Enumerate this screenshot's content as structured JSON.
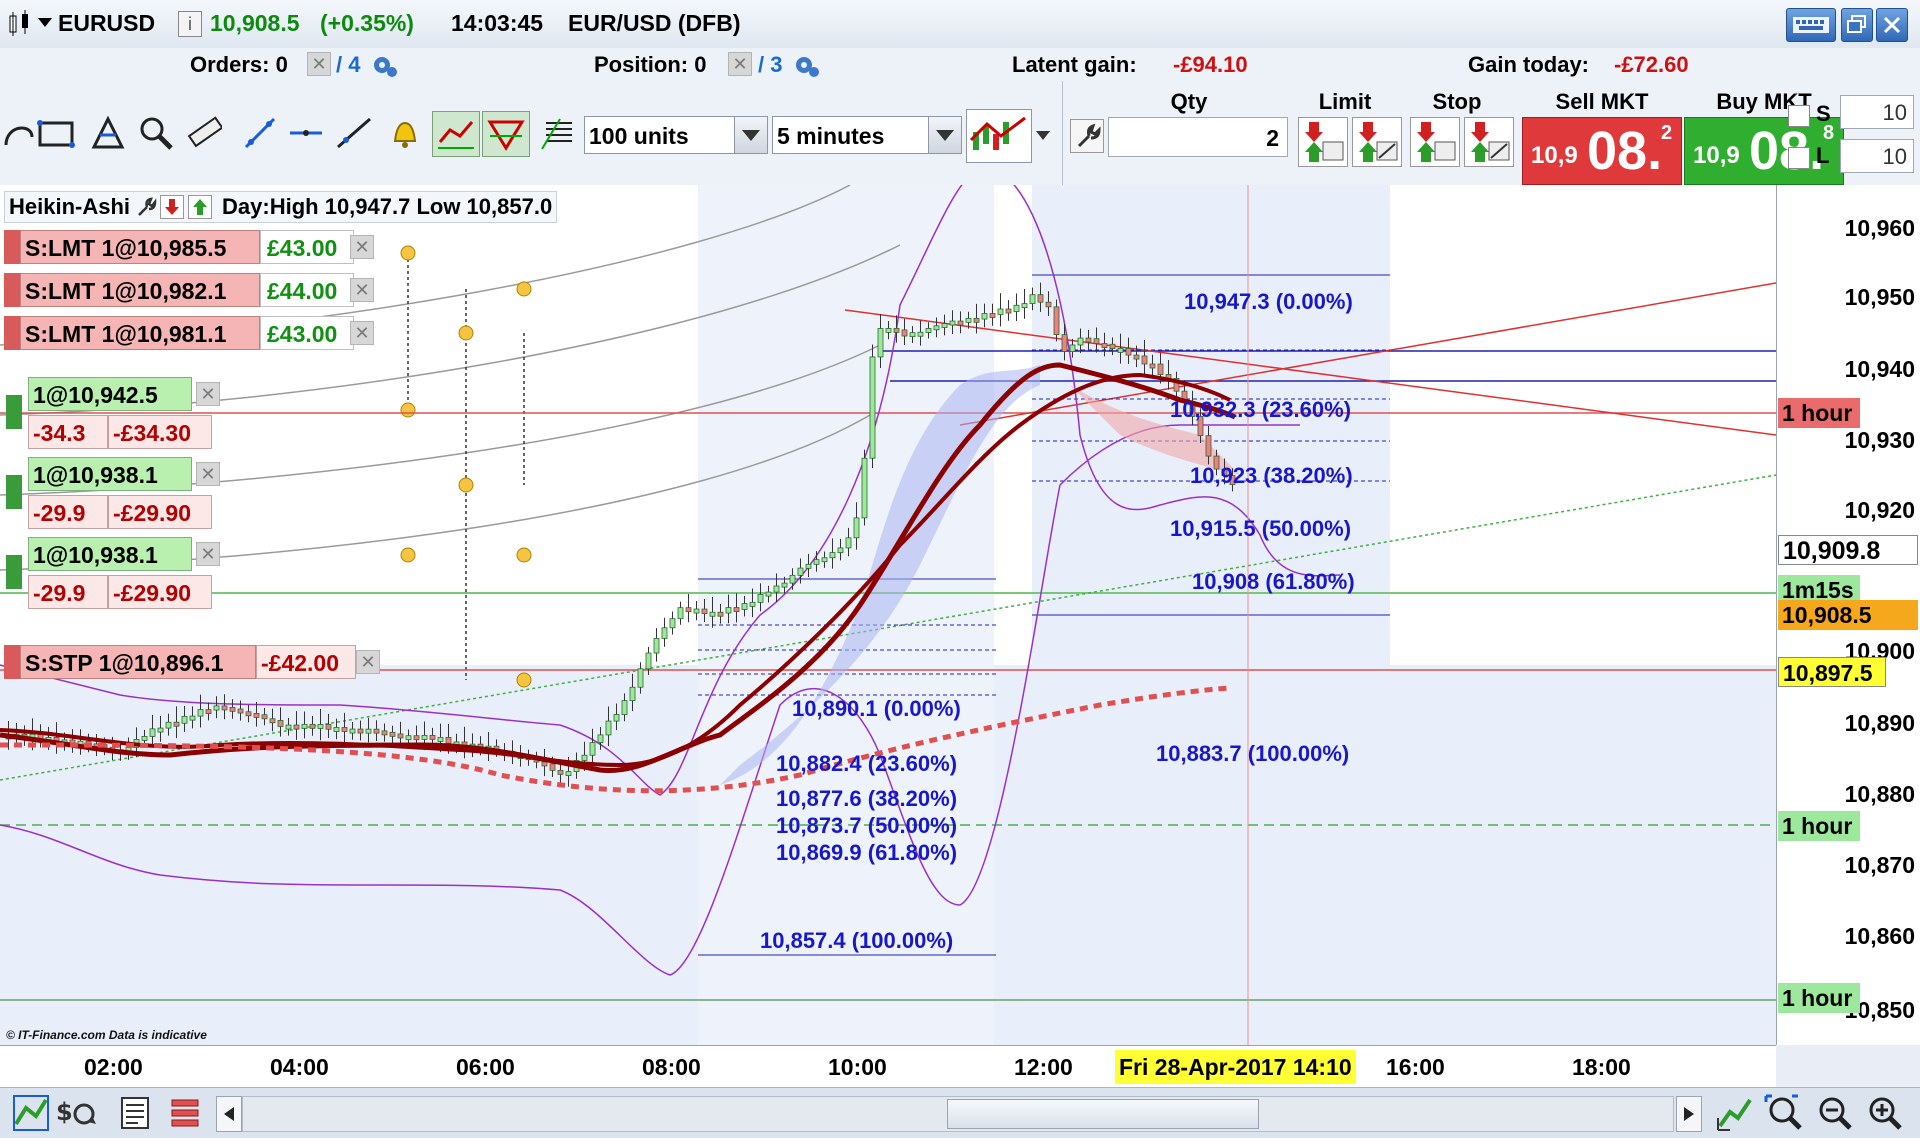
{
  "header": {
    "symbol": "EURUSD",
    "price": "10,908.5",
    "change": "(+0.35%)",
    "time": "14:03:45",
    "instrument": "EUR/USD (DFB)"
  },
  "info": {
    "orders_label": "Orders: 0",
    "orders_count": "/ 4",
    "position_label": "Position: 0",
    "position_count": "/ 3",
    "latent_label": "Latent gain:",
    "latent_value": "-£94.10",
    "today_label": "Gain today:",
    "today_value": "-£72.60"
  },
  "toolbar": {
    "units_select": "100 units",
    "interval_select": "5 minutes"
  },
  "deal": {
    "qty_label": "Qty",
    "qty_value": "2",
    "limit_label": "Limit",
    "stop_label": "Stop",
    "sell_label": "Sell MKT",
    "buy_label": "Buy MKT",
    "sell_prefix": "10,9",
    "sell_big": "08.",
    "sell_sup": "2",
    "buy_prefix": "10,9",
    "buy_big": "08.",
    "buy_sup": "8",
    "s_label": "S",
    "s_value": "10",
    "l_label": "L",
    "l_value": "10"
  },
  "chart_header": {
    "type": "Heikin-Ashi",
    "day_range": "Day:High 10,947.7 Low 10,857.0"
  },
  "orders": [
    {
      "label": "S:LMT 1@10,985.5",
      "gain": "£43.00"
    },
    {
      "label": "S:LMT 1@10,982.1",
      "gain": "£44.00"
    },
    {
      "label": "S:LMT 1@10,981.1",
      "gain": "£43.00"
    }
  ],
  "positions": [
    {
      "label": "1@10,942.5",
      "pts": "-34.3",
      "amt": "-£34.30"
    },
    {
      "label": "1@10,938.1",
      "pts": "-29.9",
      "amt": "-£29.90"
    },
    {
      "label": "1@10,938.1",
      "pts": "-29.9",
      "amt": "-£29.90"
    }
  ],
  "stop_order": {
    "label": "S:STP 1@10,896.1",
    "loss": "-£42.00"
  },
  "fib_upper": [
    "10,947.3 (0.00%)",
    "10,932.3 (23.60%)",
    "10,923 (38.20%)",
    "10,915.5 (50.00%)",
    "10,908 (61.80%)",
    "10,883.7 (100.00%)"
  ],
  "fib_lower": [
    "10,890.1 (0.00%)",
    "10,882.4 (23.60%)",
    "10,877.6 (38.20%)",
    "10,873.7 (50.00%)",
    "10,869.9 (61.80%)",
    "10,857.4 (100.00%)"
  ],
  "yaxis": {
    "ticks": [
      "10,960",
      "10,950",
      "10,940",
      "10,930",
      "10,920",
      "10,900",
      "10,890",
      "10,880",
      "10,870",
      "10,860",
      "10,850"
    ],
    "tag_1h_a": "1 hour",
    "tag_last": "10,909.8",
    "tag_timer": "1m15s",
    "tag_bid": "10,908.5",
    "tag_stop": "10,897.5",
    "tag_1h_b": "1 hour",
    "tag_1h_c": "1 hour"
  },
  "xaxis": {
    "ticks": [
      "02:00",
      "04:00",
      "06:00",
      "08:00",
      "10:00",
      "12:00",
      "16:00",
      "18:00"
    ],
    "cursor_label": "Fri 28-Apr-2017 14:10"
  },
  "copyright": "© IT-Finance.com  Data is indicative",
  "chart_data": {
    "type": "candlestick",
    "style": "Heikin-Ashi",
    "interval": "5 minutes",
    "y_range": [
      10850,
      10965
    ],
    "day_high": 10947.7,
    "day_low": 10857.0,
    "last_price": 10908.5
  },
  "colors": {
    "sell": "#e0393b",
    "buy": "#2fae2f",
    "ma": "#8b0000",
    "fib": "#1818c8",
    "band": "#9b30c8"
  }
}
